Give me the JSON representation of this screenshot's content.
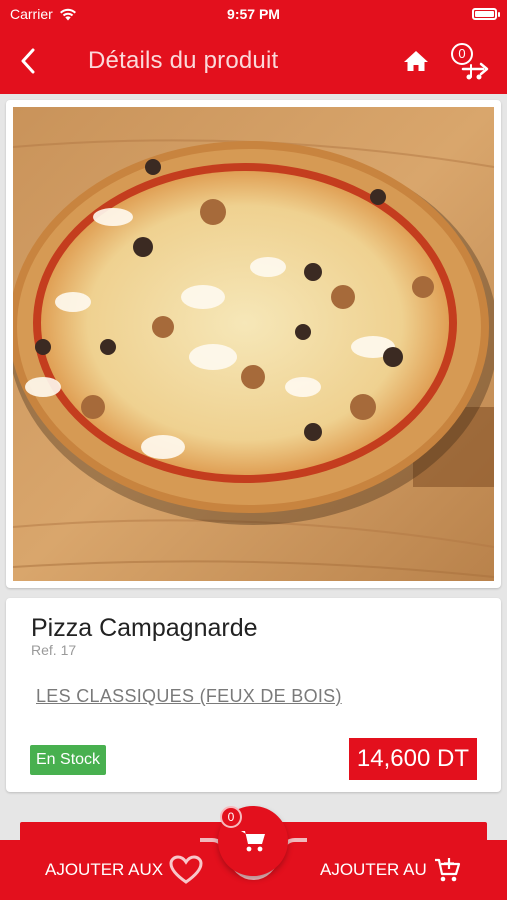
{
  "status_bar": {
    "carrier": "Carrier",
    "time": "9:57 PM"
  },
  "header": {
    "title": "Détails du produit",
    "back_icon": "chevron-left-icon",
    "home_icon": "home-icon",
    "cart_icon": "cart-arrow-icon",
    "cart_count": "0"
  },
  "product": {
    "image": "pizza-photo",
    "name": "Pizza Campagnarde",
    "ref": "Ref. 17",
    "category": "LES CLASSIQUES (FEUX DE BOIS)",
    "stock": "En Stock",
    "price": "14,600 DT"
  },
  "bottom_bar": {
    "favorites_label": "AJOUTER AUX",
    "favorites_icon": "heart-icon",
    "cart_label": "AJOUTER AU",
    "cart_add_icon": "cart-plus-icon",
    "center_cart_icon": "cart-icon",
    "center_count": "0"
  },
  "colors": {
    "primary": "#e3101d",
    "stock_green": "#48b04f",
    "background": "#e6e6e6"
  }
}
